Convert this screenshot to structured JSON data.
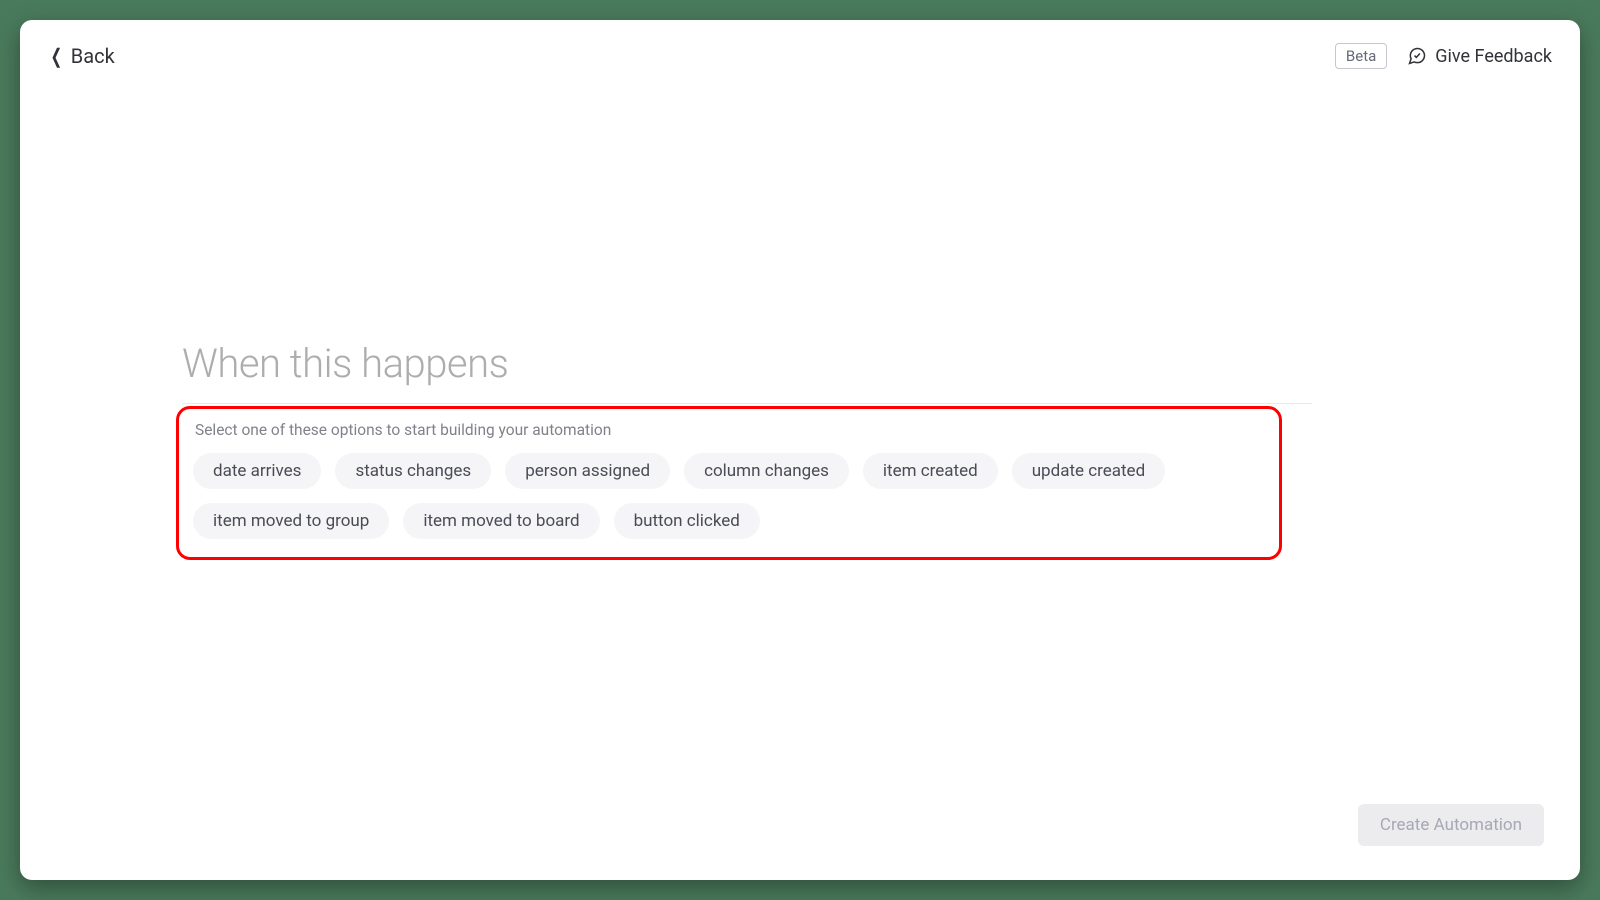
{
  "header": {
    "back_label": "Back",
    "beta_label": "Beta",
    "feedback_label": "Give Feedback"
  },
  "section": {
    "title": "When this happens",
    "helper_text": "Select one of these options to start building your automation",
    "options": [
      "date arrives",
      "status changes",
      "person assigned",
      "column changes",
      "item created",
      "update created",
      "item moved to group",
      "item moved to board",
      "button clicked"
    ]
  },
  "footer": {
    "create_label": "Create Automation"
  }
}
